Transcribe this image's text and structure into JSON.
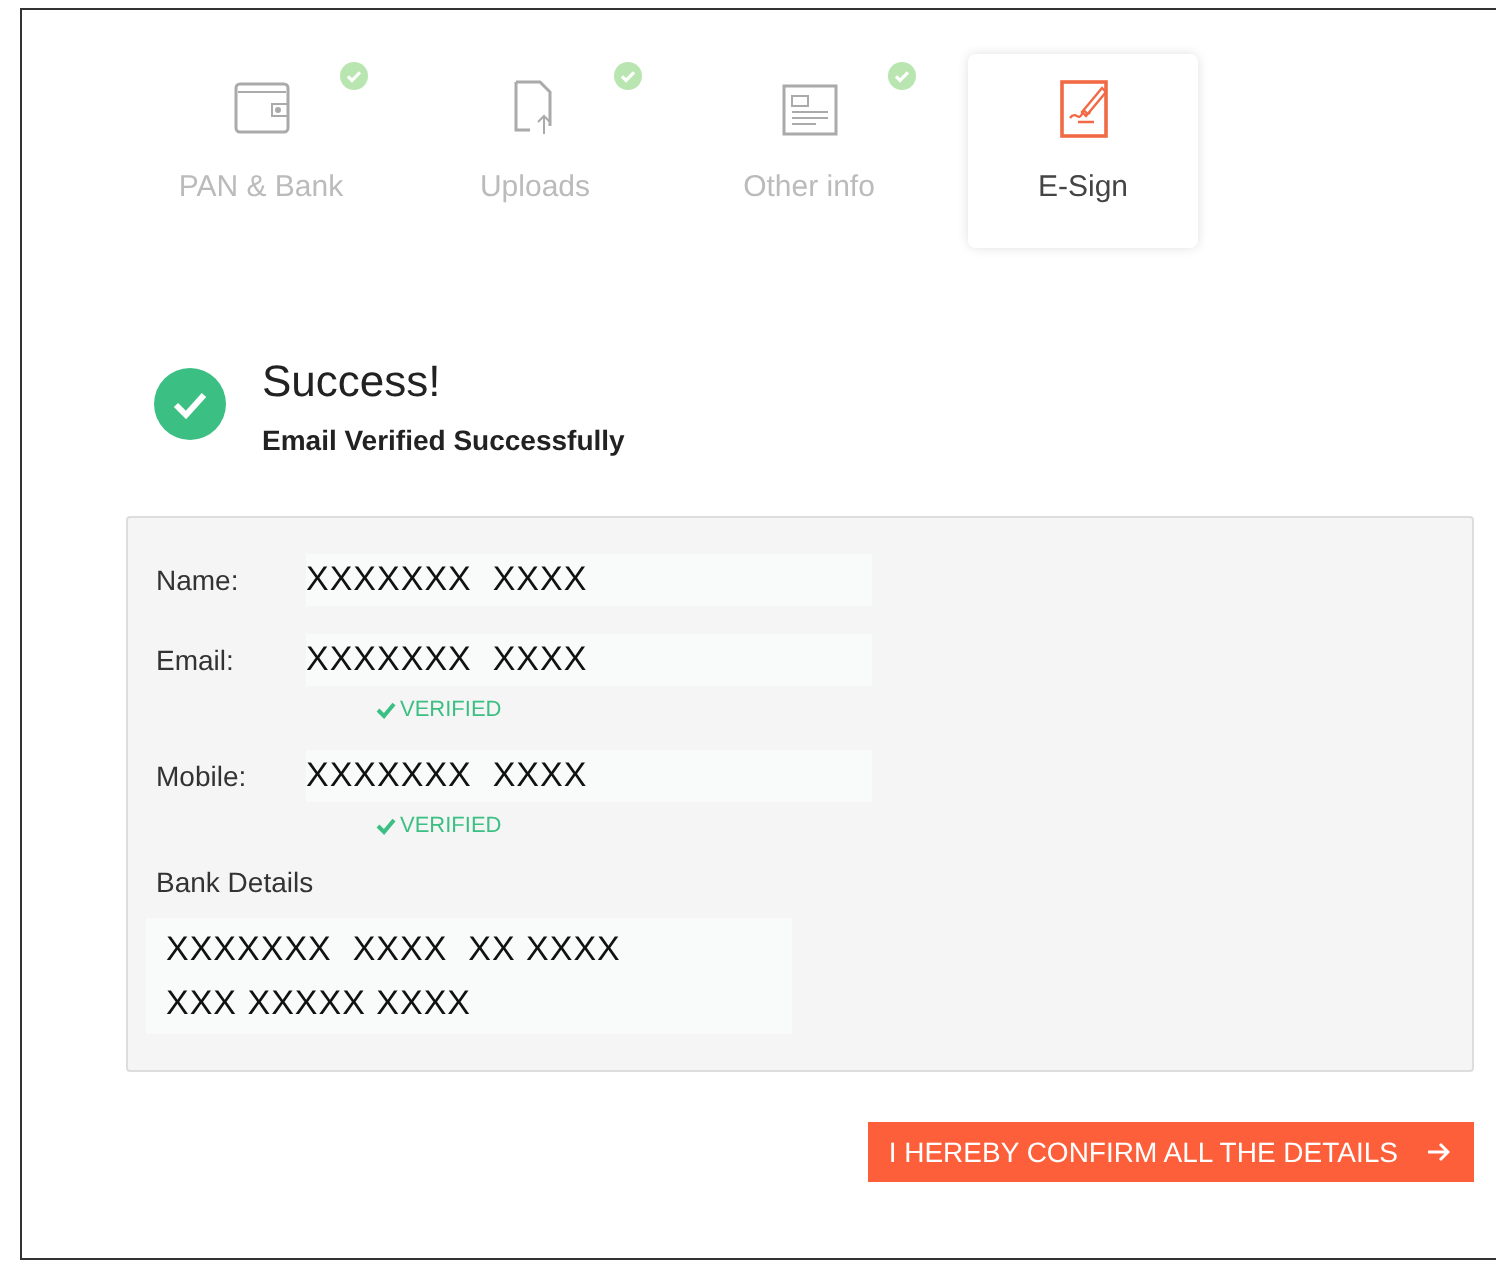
{
  "steps": [
    {
      "kind": "wallet",
      "label": "PAN & Bank",
      "done": true,
      "selected": false
    },
    {
      "kind": "upload",
      "label": "Uploads",
      "done": true,
      "selected": false
    },
    {
      "kind": "info",
      "label": "Other info",
      "done": true,
      "selected": false
    },
    {
      "kind": "esign",
      "label": "E-Sign",
      "done": false,
      "selected": true
    }
  ],
  "status": {
    "title": "Success!",
    "message": "Email Verified Successfully"
  },
  "details": [
    {
      "label": "Name:",
      "value": "XXXXXXX  XXXX"
    },
    {
      "label": "Email:",
      "value": "XXXXXXX  XXXX",
      "badge": "VERIFIED"
    },
    {
      "label": "Mobile:",
      "value": "XXXXXXX  XXXX",
      "badge": "VERIFIED"
    }
  ],
  "bank": {
    "label": "Bank Details",
    "lines": [
      "XXXXXXX  XXXX  XX XXXX",
      "XXX XXXXX XXXX"
    ]
  },
  "confirm_button": "I HEREBY CONFIRM ALL THE DETAILS"
}
